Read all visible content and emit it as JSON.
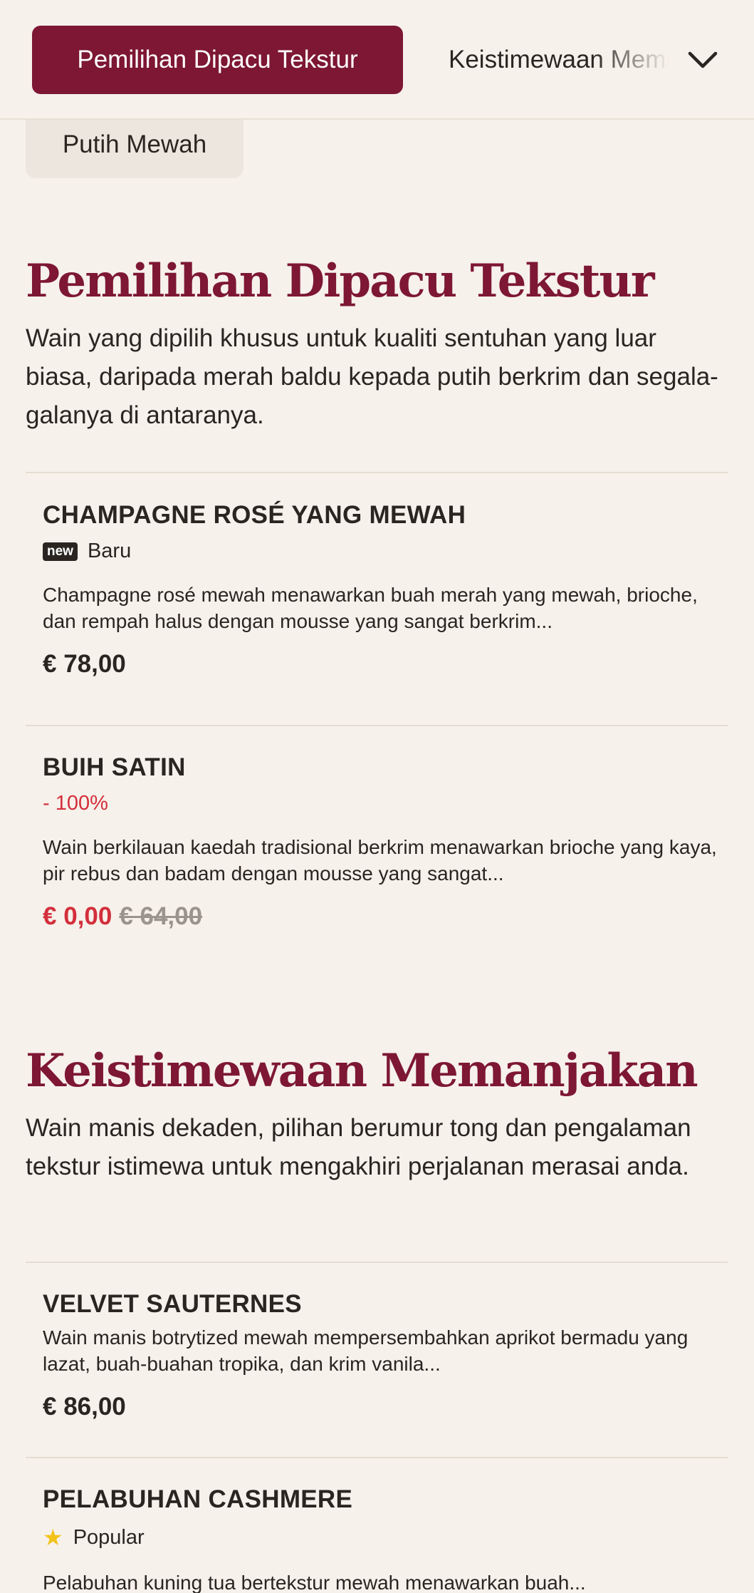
{
  "nav": {
    "active_tab": "Pemilihan Dipacu Tekstur",
    "next_tab": "Keistimewaan Memanjakan",
    "chevron_icon": "chevron-down-icon",
    "pill_label": "Putih Mewah"
  },
  "sections": [
    {
      "title": "Pemilihan Dipacu Tekstur",
      "description": "Wain yang dipilih khusus untuk kualiti sentuhan yang luar biasa, daripada merah baldu kepada putih berkrim dan segala-galanya di antaranya.",
      "items": [
        {
          "name": "CHAMPAGNE ROSÉ YANG MEWAH",
          "badge": "new",
          "tag": "Baru",
          "text": "Champagne rosé mewah menawarkan buah merah yang mewah, brioche, dan rempah halus dengan mousse yang sangat berkrim...",
          "price": "€ 78,00"
        },
        {
          "name": "BUIH SATIN",
          "tag": "- 100%",
          "text": "Wain berkilauan kaedah tradisional berkrim menawarkan brioche yang kaya, pir rebus dan badam dengan mousse yang sangat...",
          "price": "€ 0,00",
          "old_price": "€ 64,00"
        }
      ]
    },
    {
      "title": "Keistimewaan Memanjakan",
      "description": "Wain manis dekaden, pilihan berumur tong dan pengalaman tekstur istimewa untuk mengakhiri perjalanan merasai anda.",
      "items": [
        {
          "name": "VELVET SAUTERNES",
          "text": "Wain manis botrytized mewah mempersembahkan aprikot bermadu yang lazat, buah-buahan tropika, dan krim vanila...",
          "price": "€ 86,00"
        },
        {
          "name": "PELABUHAN CASHMERE",
          "tag": "Popular",
          "icon": "star-icon",
          "text": "Pelabuhan kuning tua bertekstur mewah menawarkan buah..."
        }
      ]
    }
  ],
  "colors": {
    "brand": "#7d1733",
    "background": "#f6f1ea",
    "sale": "#d32f3c",
    "star": "#f2c21b"
  }
}
